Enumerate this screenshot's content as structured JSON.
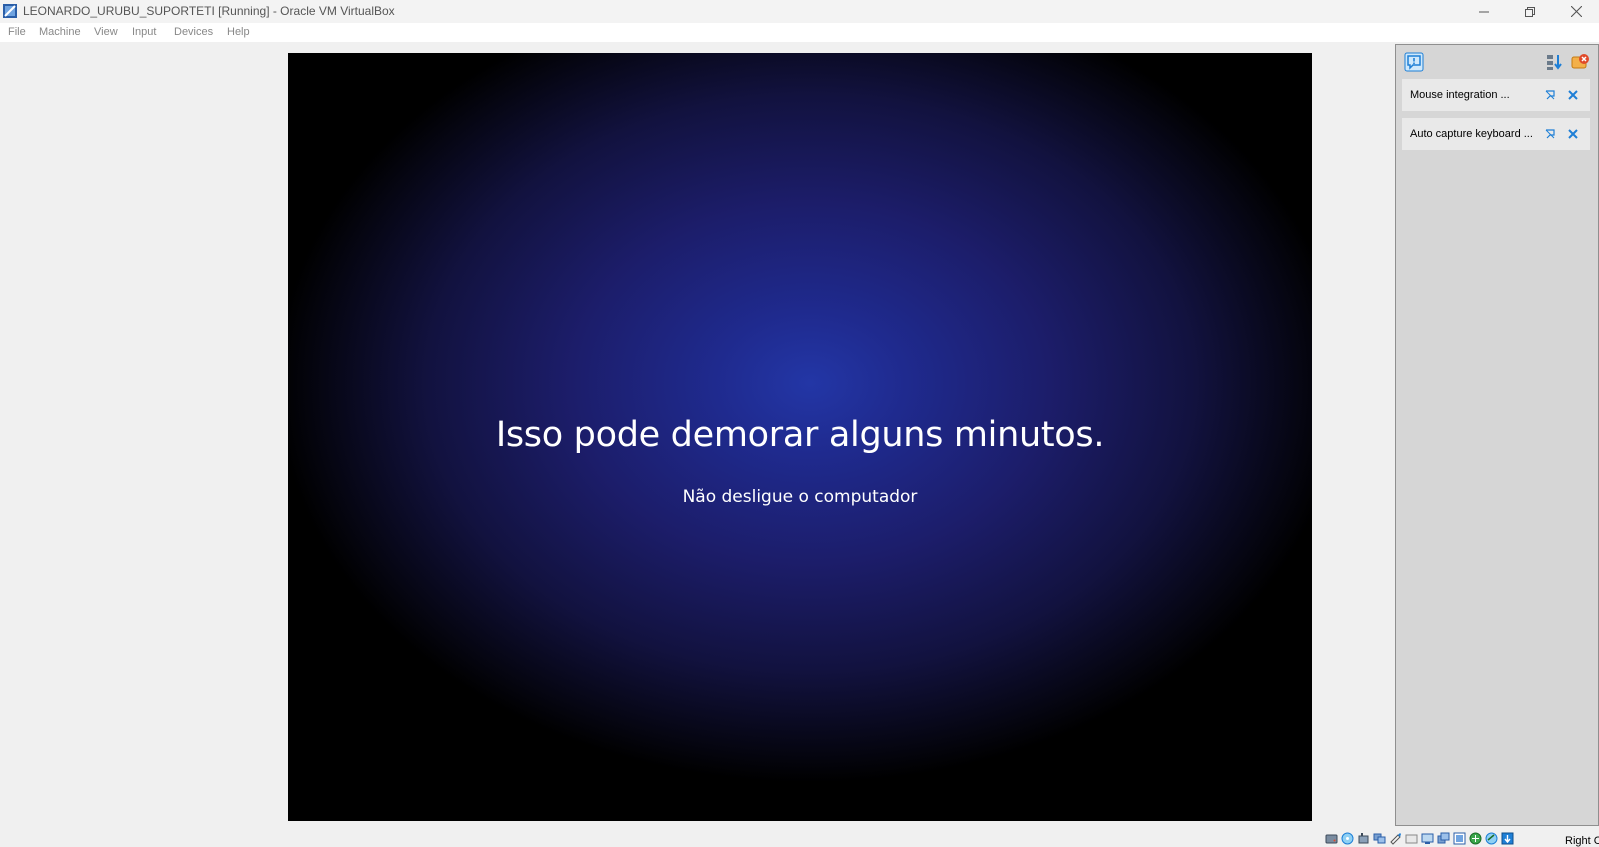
{
  "window": {
    "title": "LEONARDO_URUBU_SUPORTETI [Running] - Oracle VM VirtualBox",
    "controls": [
      "minimize-icon",
      "restore-icon",
      "close-icon"
    ]
  },
  "menu": {
    "items": [
      "File",
      "Machine",
      "View",
      "Input",
      "Devices",
      "Help"
    ]
  },
  "vm_screen": {
    "message": "Isso pode demorar alguns minutos.",
    "submessage": "Não desligue o computador"
  },
  "notification_center": {
    "header_icons": [
      "notification-center-icon",
      "sort-icon",
      "dismiss-all-icon"
    ],
    "items": [
      {
        "text": "Mouse integration ...",
        "icons": [
          "pin-icon",
          "close-icon"
        ]
      },
      {
        "text": "Auto capture keyboard ...",
        "icons": [
          "pin-icon",
          "close-icon"
        ]
      }
    ]
  },
  "status_bar": {
    "icons": [
      "hard-disk-icon",
      "optical-drive-icon",
      "audio-icon",
      "network-icon",
      "usb-icon",
      "shared-folders-icon",
      "display-icon",
      "recording-icon",
      "capture-icon",
      "cpu-icon",
      "mouse-integration-icon",
      "keyboard-icon"
    ],
    "host_key": "Right Control"
  },
  "colors": {
    "accent_blue": "#1e7fd6",
    "vm_glow": "#2336a6",
    "vm_dark": "#000000"
  }
}
